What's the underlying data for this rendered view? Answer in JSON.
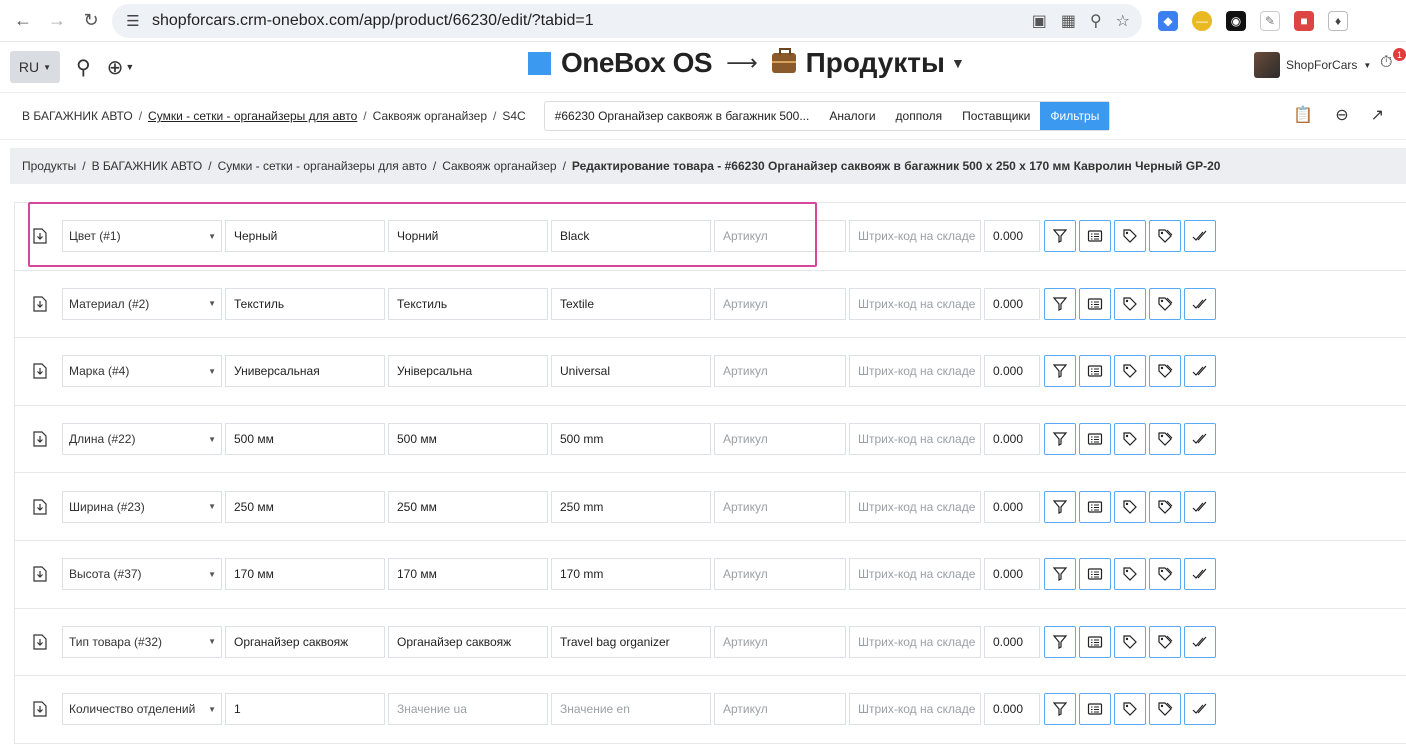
{
  "browser": {
    "url": "shopforcars.crm-onebox.com/app/product/66230/edit/?tabid=1"
  },
  "header": {
    "lang": "RU",
    "brand": "OneBox OS",
    "section": "Продукты",
    "user": "ShopForCars",
    "notifications": "1"
  },
  "breadcrumb": {
    "items": [
      "В БАГАЖНИК АВТО",
      "Сумки - сетки - органайзеры для авто",
      "Саквояж органайзер",
      "S4C"
    ]
  },
  "tabs": [
    {
      "label": "#66230 Органайзер саквояж в багажник 500..."
    },
    {
      "label": "Аналоги"
    },
    {
      "label": "допполя"
    },
    {
      "label": "Поставщики"
    },
    {
      "label": "Фильтры"
    }
  ],
  "path": {
    "items": [
      "Продукты",
      "В БАГАЖНИК АВТО",
      "Сумки - сетки - органайзеры для авто",
      "Саквояж органайзер"
    ],
    "current": "Редактирование товара - #66230 Органайзер саквояж в багажник 500 х 250 х 170 мм Кавролин Черный GP-20"
  },
  "placeholders": {
    "ua": "Значение ua",
    "en": "Значение en",
    "article": "Артикул",
    "barcode": "Штрих-код на складе"
  },
  "rows": [
    {
      "attr": "Цвет (#1)",
      "ru": "Черный",
      "ua": "Чорний",
      "en": "Black",
      "qty": "0.000"
    },
    {
      "attr": "Материал (#2)",
      "ru": "Текстиль",
      "ua": "Текстиль",
      "en": "Textile",
      "qty": "0.000"
    },
    {
      "attr": "Марка (#4)",
      "ru": "Универсальная",
      "ua": "Універсальна",
      "en": "Universal",
      "qty": "0.000"
    },
    {
      "attr": "Длина (#22)",
      "ru": "500 мм",
      "ua": "500 мм",
      "en": "500 mm",
      "qty": "0.000"
    },
    {
      "attr": "Ширина (#23)",
      "ru": "250 мм",
      "ua": "250 мм",
      "en": "250 mm",
      "qty": "0.000"
    },
    {
      "attr": "Высота (#37)",
      "ru": "170 мм",
      "ua": "170 мм",
      "en": "170 mm",
      "qty": "0.000"
    },
    {
      "attr": "Тип товара (#32)",
      "ru": "Органайзер саквояж",
      "ua": " Органайзер саквояж",
      "en": " Travel bag organizer",
      "qty": "0.000"
    },
    {
      "attr": "Количество отделений (",
      "ru": "1",
      "ua": "",
      "en": "",
      "qty": "0.000"
    }
  ]
}
